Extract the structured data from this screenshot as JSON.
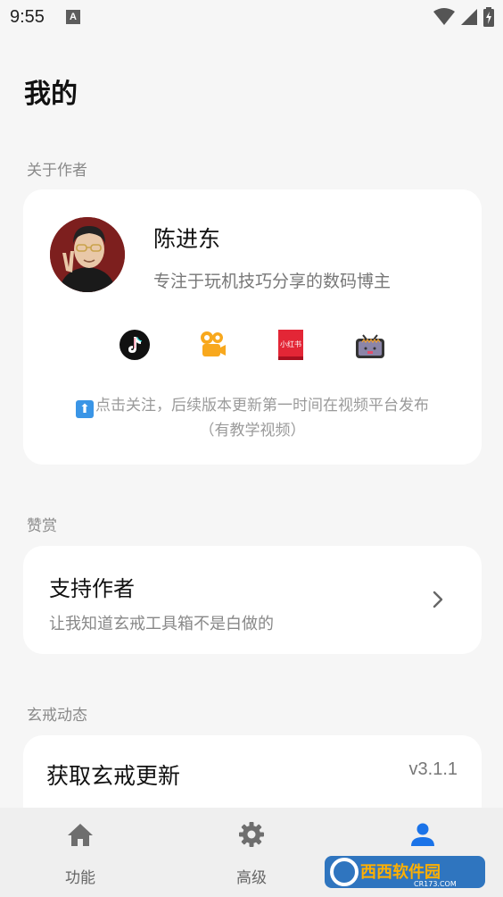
{
  "status_bar": {
    "time": "9:55",
    "notification_letter": "A"
  },
  "page": {
    "title": "我的"
  },
  "sections": {
    "about_author": "关于作者",
    "donate": "赞赏",
    "news": "玄戒动态"
  },
  "author": {
    "name": "陈进东",
    "description": "专注于玩机技巧分享的数码博主",
    "platforms": [
      "douyin-icon",
      "kuaishou-icon",
      "xiaohongshu-icon",
      "bilibili-icon"
    ],
    "xiaohongshu_label": "小红书",
    "follow_line1": "点击关注，后续版本更新第一时间在视频平台发布",
    "follow_line2": "（有教学视频）"
  },
  "support": {
    "title": "支持作者",
    "description": "让我知道玄戒工具箱不是白做的"
  },
  "update": {
    "title": "获取玄戒更新",
    "version": "v3.1.1"
  },
  "nav": {
    "items": [
      {
        "label": "功能",
        "icon": "home-icon"
      },
      {
        "label": "高级",
        "icon": "gear-icon"
      },
      {
        "label": "",
        "icon": "person-icon"
      }
    ],
    "active_color": "#1a73e8",
    "inactive_color": "#6e6e6e"
  },
  "watermark": {
    "brand": "西西软件园",
    "url": "CR173.COM"
  }
}
